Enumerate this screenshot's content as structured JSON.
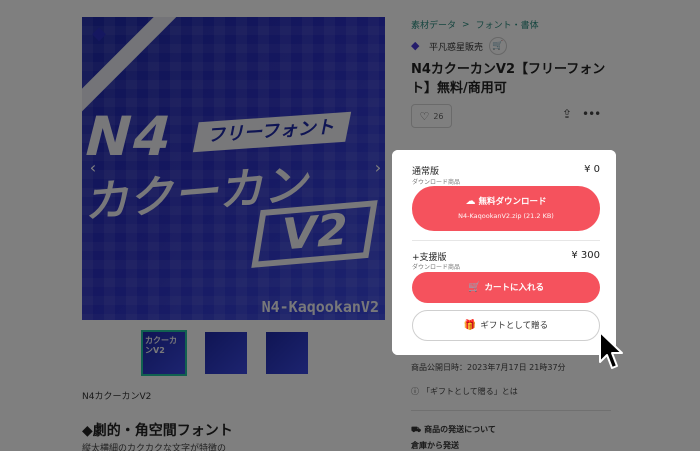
{
  "breadcrumb": [
    "素材データ",
    "フォント・書体"
  ],
  "breadcrumb_sep": ">",
  "shop": {
    "name": "平凡惑星販売"
  },
  "product": {
    "title": "N4カクーカンV2【フリーフォント】無料/商用可",
    "likes": "26",
    "caption": "N4カクーカンV2",
    "section_heading": "◆劇的・角空間フォント",
    "section_desc": "縦太横細のカクカクな文字が特徴の"
  },
  "banner": {
    "badge": "フリーフォント",
    "n4": "N4",
    "kana": "カクーカン",
    "v2": "V2",
    "footer": "N4-KaqookanV2"
  },
  "thumbs": [
    {
      "label": "カクーカンV2"
    },
    {
      "label": ""
    },
    {
      "label": ""
    }
  ],
  "free_edition": {
    "title": "通常版",
    "type": "ダウンロード商品",
    "price": "¥ 0",
    "button": "無料ダウンロード",
    "file": "N4-KaqookanV2.zip (21.2 KB)"
  },
  "support_edition": {
    "title": "+支援版",
    "type": "ダウンロード商品",
    "price": "¥ 300",
    "cart_button": "カートに入れる",
    "gift_button": "ギフトとして贈る"
  },
  "meta": {
    "published": "商品公開日時：2023年7月17日 21時37分",
    "gift_help": "「ギフトとして贈る」とは",
    "shipping_about": "商品の発送について",
    "shipping_from": "倉庫から発送"
  },
  "colors": {
    "cta": "#f5525d",
    "breadcrumb": "#2a8a7e",
    "banner": "#2b2fc0"
  }
}
